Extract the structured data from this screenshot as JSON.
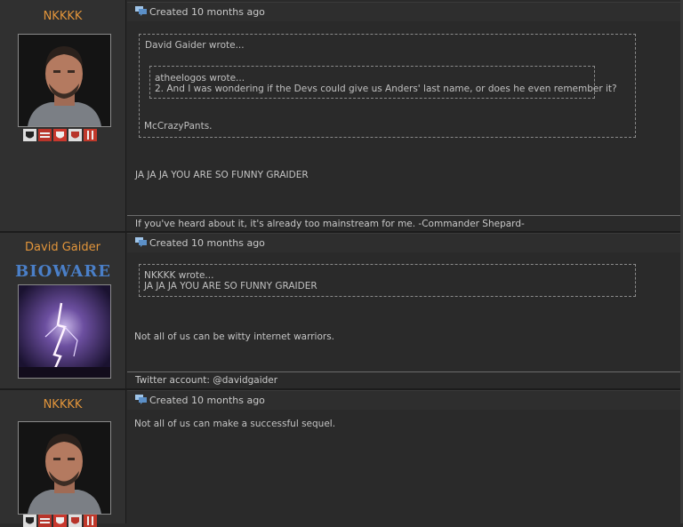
{
  "posts": [
    {
      "author": "NKKKK",
      "created": "Created 10 months ago",
      "quote_outer_header": "David Gaider wrote...",
      "quote_inner_header": "atheelogos wrote...",
      "quote_inner_text": "2. And I was wondering if the Devs could give us Anders' last name, or does he even remember it?",
      "quote_outer_text": "McCrazyPants.",
      "body": "JA JA JA YOU ARE SO FUNNY GRAIDER",
      "signature": "If you've heard about it, it's already too mainstream for me. -Commander Shepard-"
    },
    {
      "author": "David Gaider",
      "logo": "BIOWARE",
      "created": "Created 10 months ago",
      "quote_header": "NKKKK wrote...",
      "quote_text": "JA JA JA YOU ARE SO FUNNY GRAIDER",
      "body": "Not all of us can be witty internet warriors.",
      "signature": "Twitter account: @davidgaider"
    },
    {
      "author": "NKKKK",
      "created": "Created 10 months ago",
      "body": "Not all of us can make a successful sequel."
    }
  ],
  "colors": {
    "username": "#e2953b",
    "text": "#b9b9b9",
    "background": "#2a2a2a",
    "sidebar": "#303030",
    "bioware_blue": "#4a7fc8"
  },
  "icons": [
    "comment-bubble-icon",
    "badge-icon",
    "avatar-image"
  ]
}
